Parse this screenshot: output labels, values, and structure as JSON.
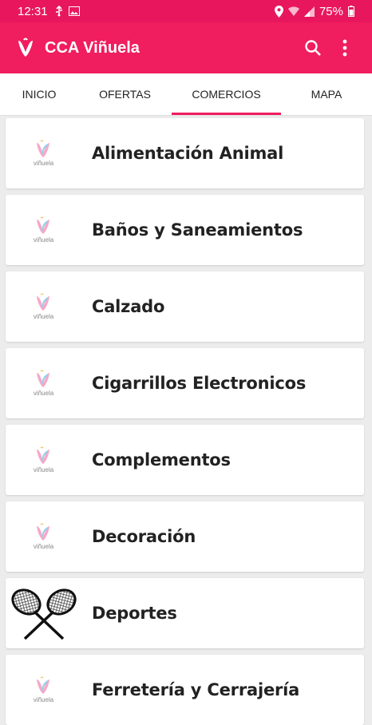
{
  "status_bar": {
    "time": "12:31",
    "battery": "75%"
  },
  "app_bar": {
    "title": "CCA Viñuela",
    "logo_icon": "vinuela-v-logo",
    "search_icon": "search-icon",
    "menu_icon": "more-vert-icon"
  },
  "tabs": [
    {
      "label": "INICIO",
      "active": false
    },
    {
      "label": "OFERTAS",
      "active": false
    },
    {
      "label": "COMERCIOS",
      "active": true
    },
    {
      "label": "MAPA",
      "active": false
    }
  ],
  "categories": [
    {
      "label": "Alimentación Animal",
      "thumb": "vinuela-logo",
      "thumb_text": "viñuela"
    },
    {
      "label": "Baños y Saneamientos",
      "thumb": "vinuela-logo",
      "thumb_text": "viñuela"
    },
    {
      "label": "Calzado",
      "thumb": "vinuela-logo",
      "thumb_text": "viñuela"
    },
    {
      "label": "Cigarrillos Electronicos",
      "thumb": "vinuela-logo",
      "thumb_text": "viñuela"
    },
    {
      "label": "Complementos",
      "thumb": "vinuela-logo",
      "thumb_text": "viñuela"
    },
    {
      "label": "Decoración",
      "thumb": "vinuela-logo",
      "thumb_text": "viñuela"
    },
    {
      "label": "Deportes",
      "thumb": "tennis-rackets-icon"
    },
    {
      "label": "Ferretería y Cerrajería",
      "thumb": "vinuela-logo",
      "thumb_text": "viñuela"
    }
  ],
  "colors": {
    "primary": "#f01d5f",
    "status_bar": "#e8175d",
    "background": "#ececec"
  }
}
